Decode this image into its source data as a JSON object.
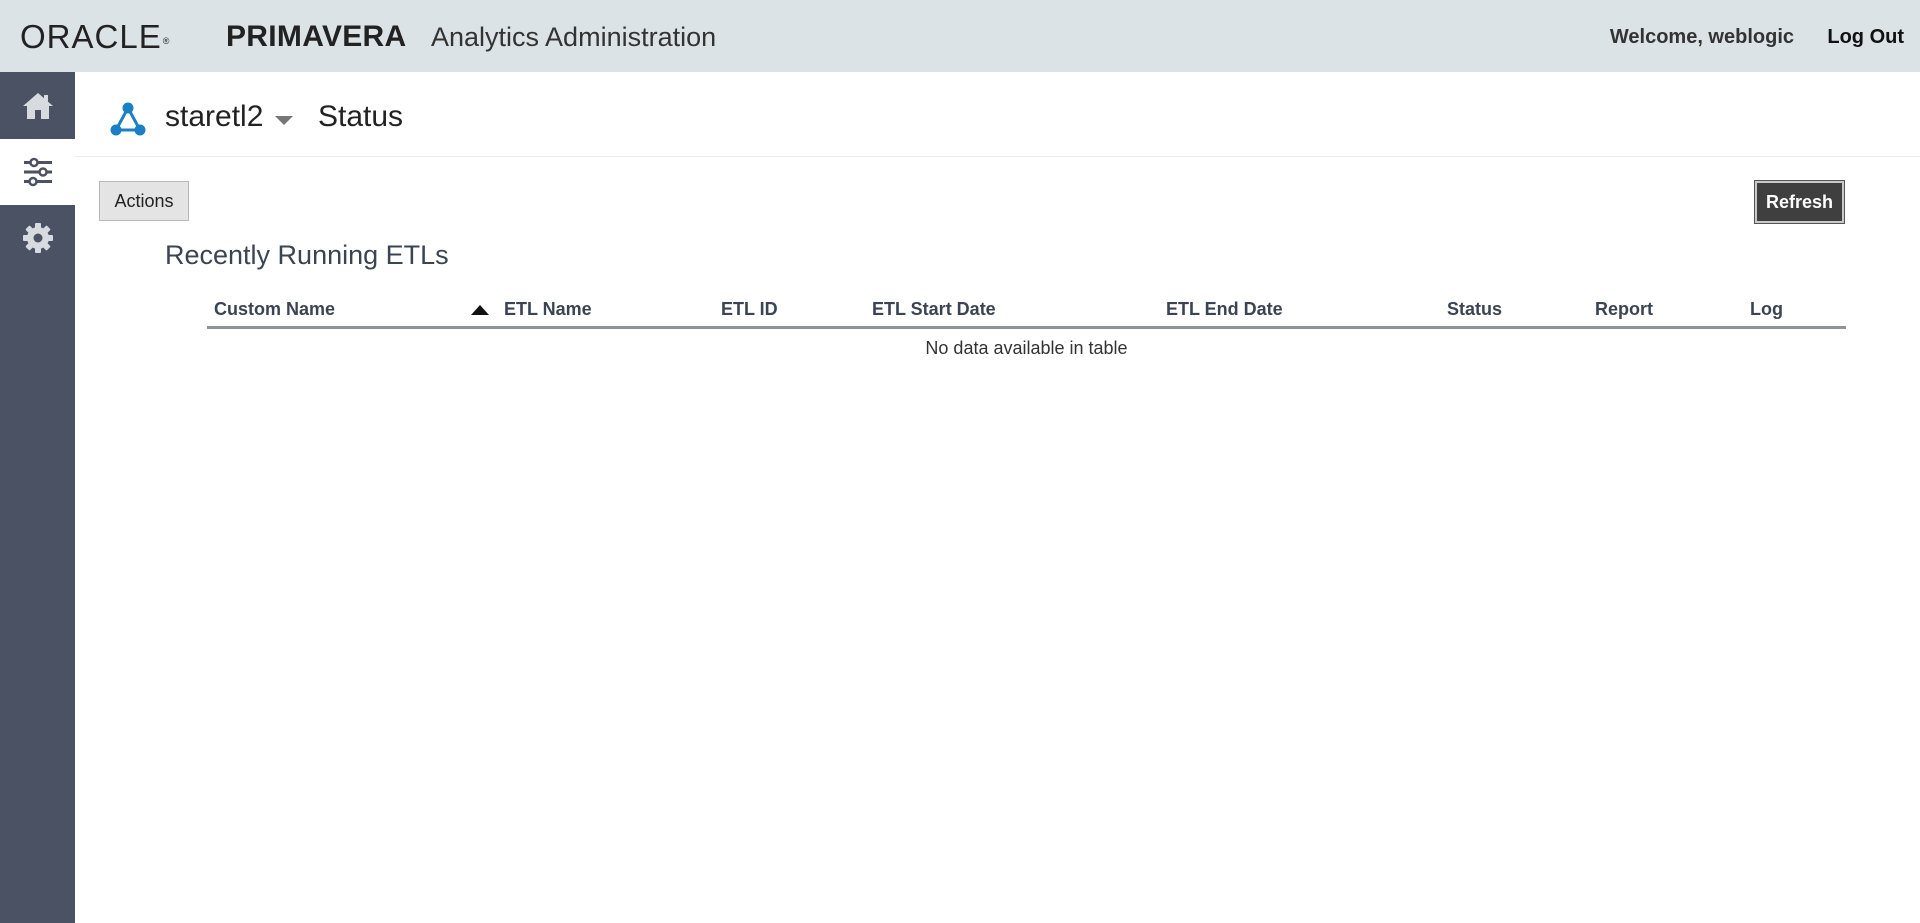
{
  "header": {
    "oracle_logo": "ORACLE",
    "product_logo": "PRIMAVERA",
    "app_title": "Analytics Administration",
    "welcome_text": "Welcome, weblogic",
    "logout_label": "Log Out"
  },
  "sidebar": {
    "items": [
      {
        "name": "home",
        "icon": "home-icon",
        "active": false
      },
      {
        "name": "configuration",
        "icon": "sliders-icon",
        "active": true
      },
      {
        "name": "settings",
        "icon": "gear-icon",
        "active": false
      }
    ]
  },
  "page": {
    "project_icon": "network-icon",
    "project_name": "staretl2",
    "title": "Status"
  },
  "toolbar": {
    "actions_label": "Actions",
    "refresh_label": "Refresh"
  },
  "section": {
    "title": "Recently Running ETLs"
  },
  "table": {
    "columns": [
      "Custom Name",
      "ETL Name",
      "ETL ID",
      "ETL Start Date",
      "ETL End Date",
      "Status",
      "Report",
      "Log"
    ],
    "sorted_column": "ETL Name",
    "sort_direction": "ascending",
    "rows": [],
    "empty_message": "No data available in table"
  },
  "colors": {
    "header_bg": "#dce3e6",
    "sidebar_bg": "#4b5263",
    "refresh_bg": "#3f3f3f",
    "accent_blue": "#1a7fc4"
  }
}
